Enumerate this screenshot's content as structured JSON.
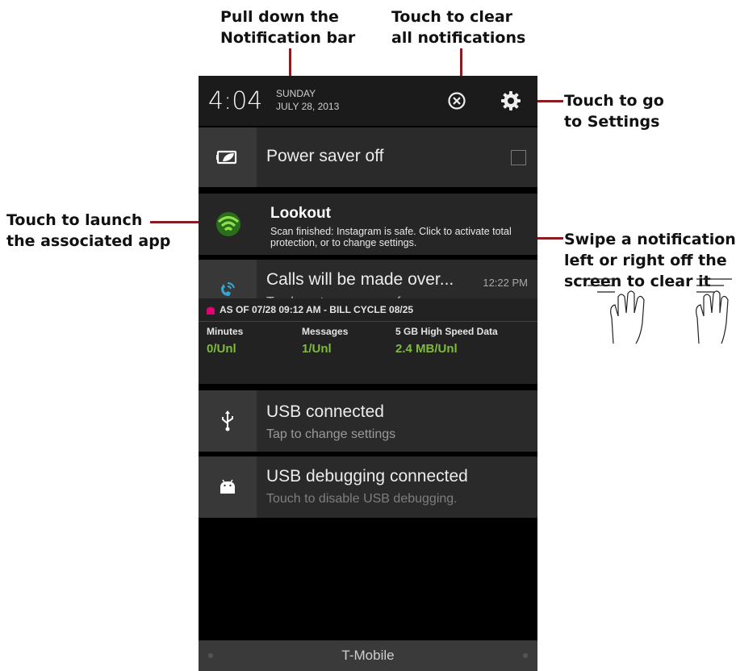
{
  "annotations": {
    "pull_down": [
      "Pull down the",
      "Notification bar"
    ],
    "clear_all": [
      "Touch to clear",
      "all notifications"
    ],
    "settings": [
      "Touch to go",
      "to Settings"
    ],
    "launch_app": [
      "Touch to launch",
      "the associated app"
    ],
    "swipe": [
      "Swipe a notification",
      "left or right off the",
      "screen to clear it"
    ]
  },
  "status_bar": {
    "time": "4:04",
    "day": "SUNDAY",
    "date": "JULY 28, 2013",
    "clear_icon": "clear-all-circle-x",
    "settings_icon": "gear"
  },
  "notifications": [
    {
      "id": "power-saver",
      "icon": "battery-leaf-icon",
      "title": "Power saver off"
    },
    {
      "id": "lookout",
      "icon": "wifi-shield-icon",
      "title": "Lookout",
      "text": "Scan finished: Instagram is safe. Click to activate total protection, or to change settings."
    },
    {
      "id": "wifi-calling",
      "icon": "wifi-call-icon",
      "title": "Calls will be made over...",
      "subtitle": "Tap here to access preferences",
      "time": "12:22 PM"
    },
    {
      "id": "usb",
      "icon": "usb-icon",
      "title": "USB connected",
      "subtitle": "Tap to change settings"
    },
    {
      "id": "usb-debug",
      "icon": "android-icon",
      "title": "USB debugging connected",
      "subtitle": "Touch to disable USB debugging."
    }
  ],
  "plan_usage": {
    "header": "AS OF  07/28 09:12 AM - BILL CYCLE 08/25",
    "minutes_label": "Minutes",
    "minutes_value": "0/Unl",
    "messages_label": "Messages",
    "messages_value": "1/Unl",
    "data_label": "5 GB High Speed Data",
    "data_value": "2.4 MB/Unl"
  },
  "carrier": "T-Mobile",
  "colors": {
    "leader": "#8b1d22",
    "accent_green": "#7fbb3a",
    "wifi_blue": "#35a6d8"
  }
}
